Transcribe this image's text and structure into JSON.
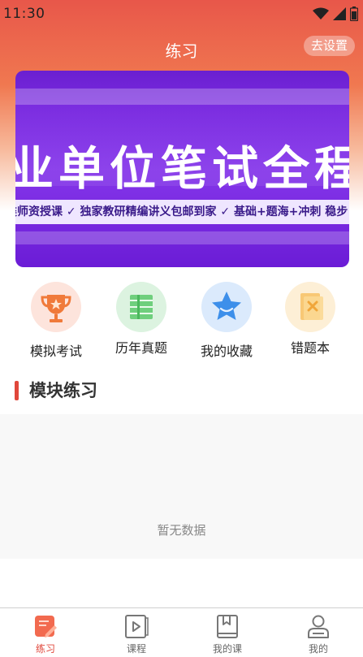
{
  "status_bar": {
    "time": "11:30"
  },
  "header": {
    "title": "练习",
    "settings_label": "去设置"
  },
  "banner": {
    "headline": "业单位笔试全程",
    "tagline": "类师资授课  ✓ 独家教研精编讲义包邮到家  ✓ 基础+题海+冲刺 稳步"
  },
  "quick_actions": [
    {
      "label": "模拟考试",
      "icon": "trophy-icon"
    },
    {
      "label": "历年真题",
      "icon": "book-stack-icon"
    },
    {
      "label": "我的收藏",
      "icon": "star-icon"
    },
    {
      "label": "错题本",
      "icon": "mistake-notebook-icon"
    }
  ],
  "section": {
    "title": "模块练习"
  },
  "empty_state": {
    "text": "暂无数据"
  },
  "tab_bar": {
    "active": "练习",
    "tabs": [
      {
        "label": "练习",
        "icon": "practice-icon"
      },
      {
        "label": "课程",
        "icon": "course-video-icon"
      },
      {
        "label": "我的课",
        "icon": "my-course-icon"
      },
      {
        "label": "我的",
        "icon": "profile-icon"
      }
    ]
  },
  "colors": {
    "accent": "#e0473b",
    "banner": "#7a2be0"
  }
}
